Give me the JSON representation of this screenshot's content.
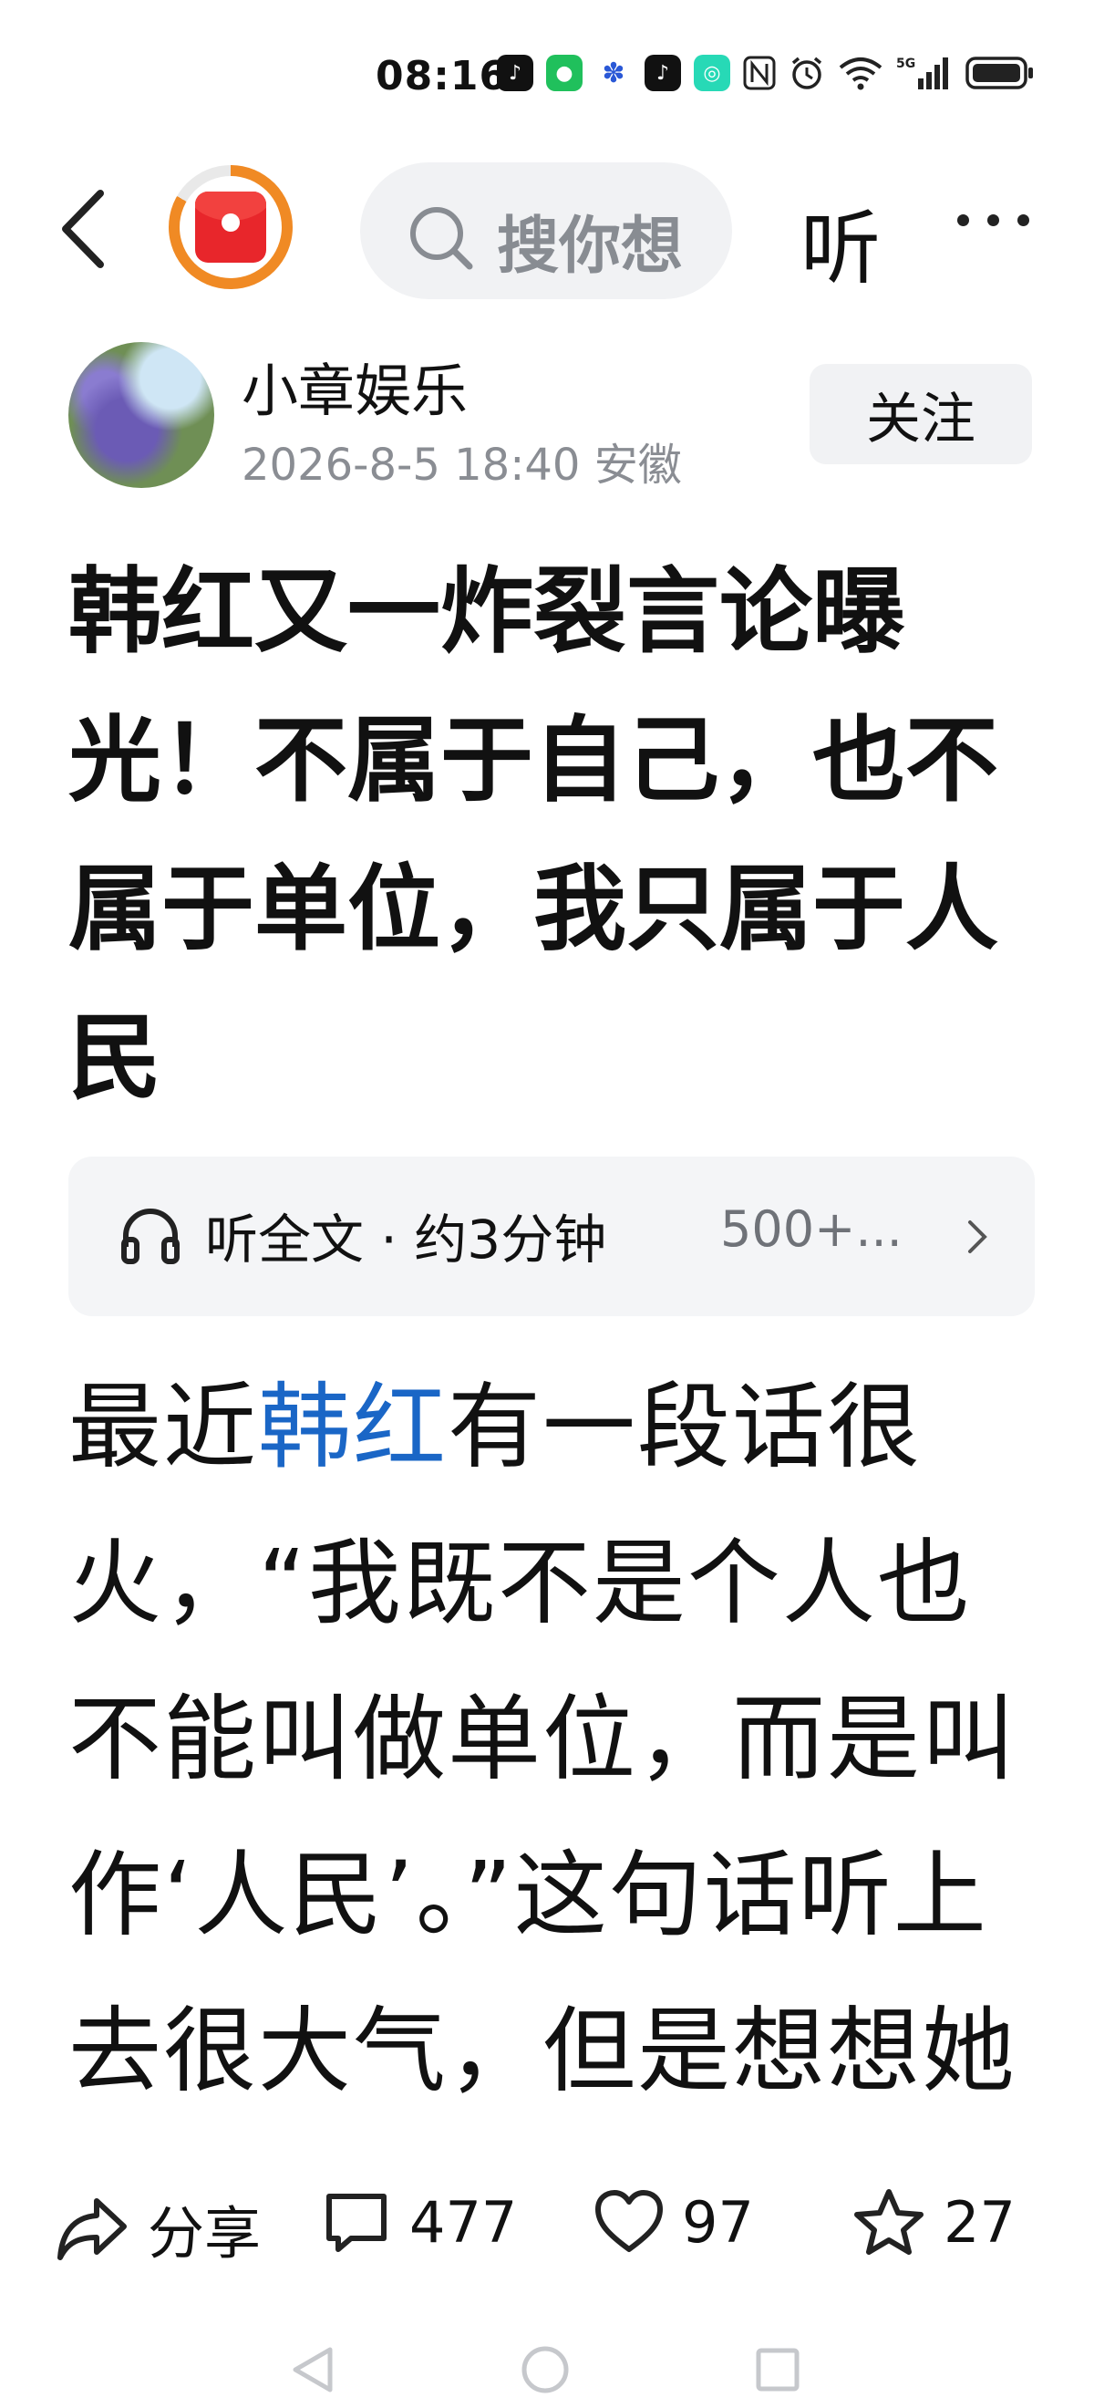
{
  "status_bar": {
    "time": "08:16",
    "network": "5G",
    "icons": [
      "douyin-icon",
      "wechat-icon",
      "baidu-icon",
      "tiktok-icon",
      "soul-icon",
      "nfc-icon",
      "alarm-icon",
      "wifi-icon",
      "signal-icon",
      "battery-icon"
    ]
  },
  "nav": {
    "search_placeholder": "搜你想",
    "listen_label": "听"
  },
  "author": {
    "name": "小章娱乐",
    "date": "2026-8-5",
    "time": "18:40",
    "location": "安徽",
    "follow_label": "关注"
  },
  "article": {
    "title": "韩红又一炸裂言论曝光！不属于自己，也不属于单位，我只属于人民",
    "listen_text": "听全文 · 约3分钟",
    "listen_count": "500+...",
    "body_before": "最近",
    "body_link": "韩红",
    "body_after": "有一段话很火，“我既不是个人也不能叫做单位，而是叫作‘人民’。”这句话听上去很大气，但是想想她"
  },
  "actions": {
    "share_label": "分享",
    "comments": "477",
    "likes": "97",
    "favorites": "27"
  },
  "colors": {
    "link": "#1a66c6",
    "red_packet": "#e8262b",
    "progress_ring": "#f08a24"
  }
}
